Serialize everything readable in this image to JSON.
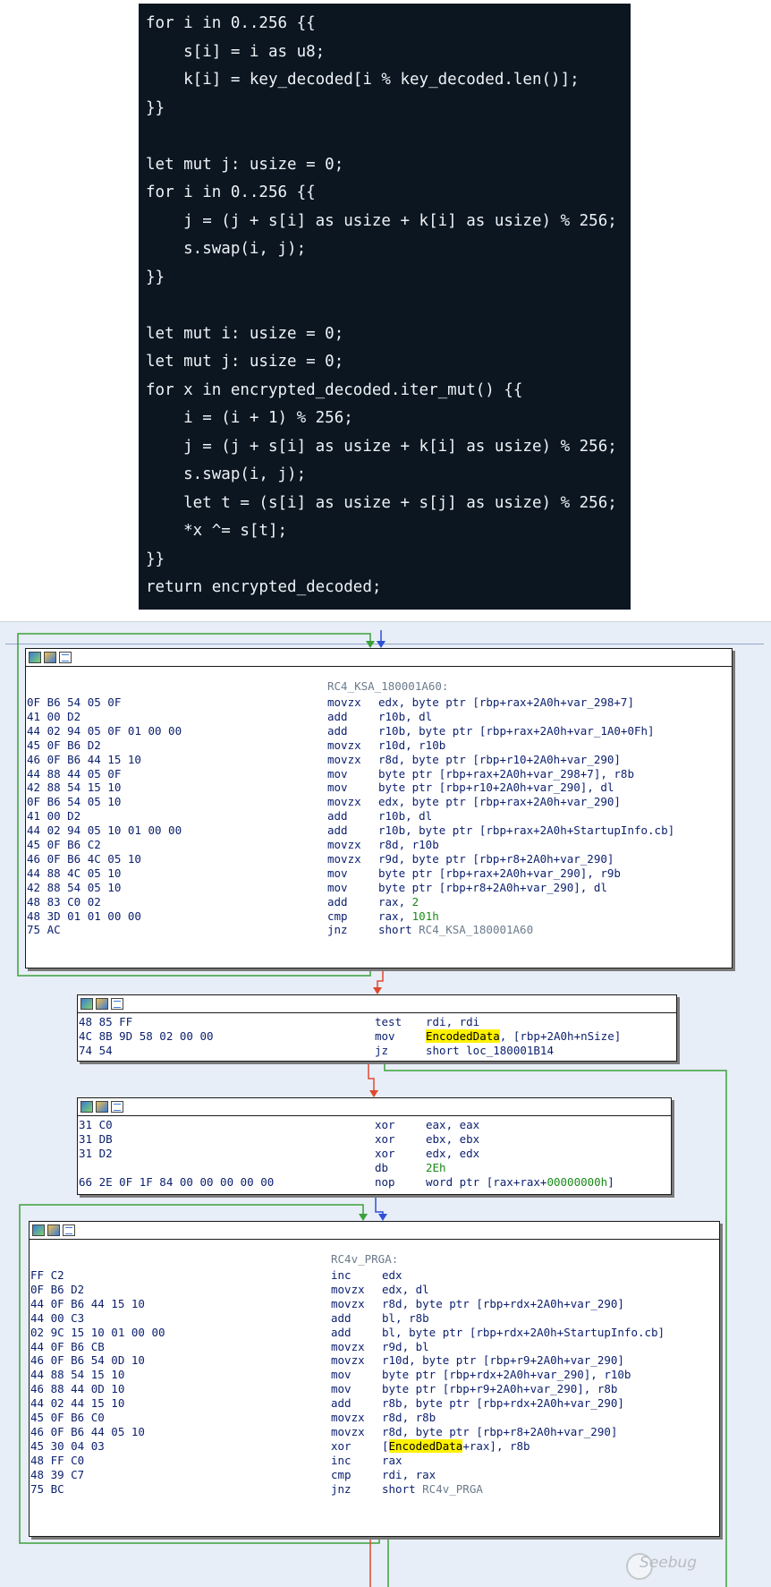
{
  "rust_code": {
    "lines": [
      "for i in 0..256 {{",
      "    s[i] = i as u8;",
      "    k[i] = key_decoded[i % key_decoded.len()];",
      "}}",
      "",
      "let mut j: usize = 0;",
      "for i in 0..256 {{",
      "    j = (j + s[i] as usize + k[i] as usize) % 256;",
      "    s.swap(i, j);",
      "}}",
      "",
      "let mut i: usize = 0;",
      "let mut j: usize = 0;",
      "for x in encrypted_decoded.iter_mut() {{",
      "    i = (i + 1) % 256;",
      "    j = (j + s[i] as usize + k[i] as usize) % 256;",
      "    s.swap(i, j);",
      "    let t = (s[i] as usize + s[j] as usize) % 256;",
      "    *x ^= s[t];",
      "}}",
      "return encrypted_decoded;"
    ]
  },
  "ida_graph": {
    "ksa_block": {
      "label": "RC4_KSA_180001A60:",
      "rows": [
        {
          "bytes": "0F B6 54 05 0F",
          "mnem": "movzx",
          "ops": "edx, byte ptr [rbp+rax+2A0h+var_298+7]"
        },
        {
          "bytes": "41 00 D2",
          "mnem": "add",
          "ops": "r10b, dl"
        },
        {
          "bytes": "44 02 94 05 0F 01 00 00",
          "mnem": "add",
          "ops": "r10b, byte ptr [rbp+rax+2A0h+var_1A0+0Fh]"
        },
        {
          "bytes": "45 0F B6 D2",
          "mnem": "movzx",
          "ops": "r10d, r10b"
        },
        {
          "bytes": "46 0F B6 44 15 10",
          "mnem": "movzx",
          "ops": "r8d, byte ptr [rbp+r10+2A0h+var_290]"
        },
        {
          "bytes": "44 88 44 05 0F",
          "mnem": "mov",
          "ops": "byte ptr [rbp+rax+2A0h+var_298+7], r8b"
        },
        {
          "bytes": "42 88 54 15 10",
          "mnem": "mov",
          "ops": "byte ptr [rbp+r10+2A0h+var_290], dl"
        },
        {
          "bytes": "0F B6 54 05 10",
          "mnem": "movzx",
          "ops": "edx, byte ptr [rbp+rax+2A0h+var_290]"
        },
        {
          "bytes": "41 00 D2",
          "mnem": "add",
          "ops": "r10b, dl"
        },
        {
          "bytes": "44 02 94 05 10 01 00 00",
          "mnem": "add",
          "ops": "r10b, byte ptr [rbp+rax+2A0h+StartupInfo.cb]"
        },
        {
          "bytes": "45 0F B6 C2",
          "mnem": "movzx",
          "ops": "r8d, r10b"
        },
        {
          "bytes": "46 0F B6 4C 05 10",
          "mnem": "movzx",
          "ops": "r9d, byte ptr [rbp+r8+2A0h+var_290]"
        },
        {
          "bytes": "44 88 4C 05 10",
          "mnem": "mov",
          "ops": "byte ptr [rbp+rax+2A0h+var_290], r9b"
        },
        {
          "bytes": "42 88 54 05 10",
          "mnem": "mov",
          "ops": "byte ptr [rbp+r8+2A0h+var_290], dl"
        },
        {
          "bytes": "48 83 C0 02",
          "mnem": "add",
          "ops_a": "rax, ",
          "ops_num": "2"
        },
        {
          "bytes": "48 3D 01 01 00 00",
          "mnem": "cmp",
          "ops_a": "rax, ",
          "ops_num": "101h"
        },
        {
          "bytes": "75 AC",
          "mnem": "jnz",
          "ops_a": "short ",
          "ops_gray": "RC4_KSA_180001A60"
        }
      ]
    },
    "test_block": {
      "rows": [
        {
          "bytes": "48 85 FF",
          "mnem": "test",
          "ops": "rdi, rdi"
        },
        {
          "bytes": "4C 8B 9D 58 02 00 00",
          "mnem": "mov",
          "ops_hl": "EncodedData",
          "ops_b": ", [rbp+2A0h+nSize]"
        },
        {
          "bytes": "74 54",
          "mnem": "jz",
          "ops": "short loc_180001B14"
        }
      ]
    },
    "xor_block": {
      "rows": [
        {
          "bytes": "31 C0",
          "mnem": "xor",
          "ops": "eax, eax"
        },
        {
          "bytes": "31 DB",
          "mnem": "xor",
          "ops": "ebx, ebx"
        },
        {
          "bytes": "31 D2",
          "mnem": "xor",
          "ops": "edx, edx"
        },
        {
          "bytes": "",
          "mnem": "db",
          "ops_num": "2Eh"
        },
        {
          "bytes": "66 2E 0F 1F 84 00 00 00 00 00",
          "mnem": "nop",
          "ops_a": "word ptr [rax+rax+",
          "ops_num": "00000000h",
          "ops_b": "]"
        }
      ]
    },
    "prga_block": {
      "label": "RC4v_PRGA:",
      "rows": [
        {
          "bytes": "FF C2",
          "mnem": "inc",
          "ops": "edx"
        },
        {
          "bytes": "0F B6 D2",
          "mnem": "movzx",
          "ops": "edx, dl"
        },
        {
          "bytes": "44 0F B6 44 15 10",
          "mnem": "movzx",
          "ops": "r8d, byte ptr [rbp+rdx+2A0h+var_290]"
        },
        {
          "bytes": "44 00 C3",
          "mnem": "add",
          "ops": "bl, r8b"
        },
        {
          "bytes": "02 9C 15 10 01 00 00",
          "mnem": "add",
          "ops": "bl, byte ptr [rbp+rdx+2A0h+StartupInfo.cb]"
        },
        {
          "bytes": "44 0F B6 CB",
          "mnem": "movzx",
          "ops": "r9d, bl"
        },
        {
          "bytes": "46 0F B6 54 0D 10",
          "mnem": "movzx",
          "ops": "r10d, byte ptr [rbp+r9+2A0h+var_290]"
        },
        {
          "bytes": "44 88 54 15 10",
          "mnem": "mov",
          "ops": "byte ptr [rbp+rdx+2A0h+var_290], r10b"
        },
        {
          "bytes": "46 88 44 0D 10",
          "mnem": "mov",
          "ops": "byte ptr [rbp+r9+2A0h+var_290], r8b"
        },
        {
          "bytes": "44 02 44 15 10",
          "mnem": "add",
          "ops": "r8b, byte ptr [rbp+rdx+2A0h+var_290]"
        },
        {
          "bytes": "45 0F B6 C0",
          "mnem": "movzx",
          "ops": "r8d, r8b"
        },
        {
          "bytes": "46 0F B6 44 05 10",
          "mnem": "movzx",
          "ops": "r8d, byte ptr [rbp+r8+2A0h+var_290]"
        },
        {
          "bytes": "45 30 04 03",
          "mnem": "xor",
          "ops_a": "[",
          "ops_hl": "EncodedData",
          "ops_b": "+rax], r8b"
        },
        {
          "bytes": "48 FF C0",
          "mnem": "inc",
          "ops": "rax"
        },
        {
          "bytes": "48 39 C7",
          "mnem": "cmp",
          "ops": "rdi, rax"
        },
        {
          "bytes": "75 BC",
          "mnem": "jnz",
          "ops_a": "short ",
          "ops_gray": "RC4v_PRGA"
        }
      ]
    },
    "edge_colors": {
      "true": "#3aa03a",
      "false": "#e0482e",
      "normal": "#2f4fd6"
    },
    "watermark": "Seebug"
  }
}
